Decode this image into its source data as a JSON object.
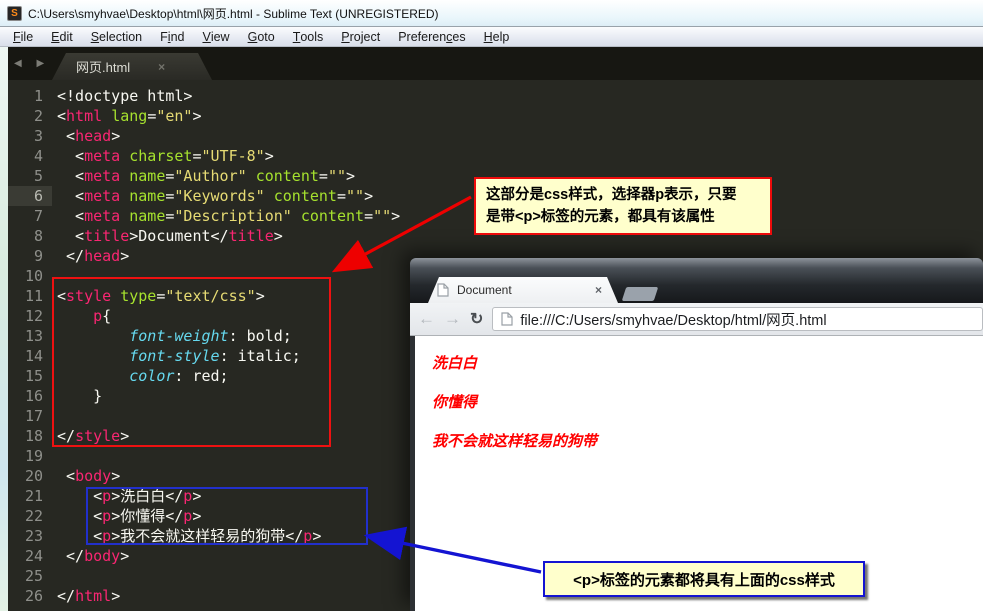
{
  "window": {
    "title": "C:\\Users\\smyhvae\\Desktop\\html\\网页.html - Sublime Text (UNREGISTERED)",
    "icon_letter": "S"
  },
  "menu": {
    "items": [
      {
        "label": "File",
        "u": 0
      },
      {
        "label": "Edit",
        "u": 0
      },
      {
        "label": "Selection",
        "u": 0
      },
      {
        "label": "Find",
        "u": 1
      },
      {
        "label": "View",
        "u": 0
      },
      {
        "label": "Goto",
        "u": 0
      },
      {
        "label": "Tools",
        "u": 0
      },
      {
        "label": "Project",
        "u": 0
      },
      {
        "label": "Preferences",
        "u": 8
      },
      {
        "label": "Help",
        "u": 0
      }
    ]
  },
  "tabbar": {
    "nav_arrows": "◀ ▶",
    "tab_label": "网页.html",
    "tab_close": "×"
  },
  "editor": {
    "highlighted_line": 6,
    "lines": [
      {
        "n": 1,
        "segs": [
          [
            "w",
            "<!doctype html>"
          ]
        ]
      },
      {
        "n": 2,
        "segs": [
          [
            "w",
            "<"
          ],
          [
            "p",
            "html"
          ],
          [
            "w",
            " "
          ],
          [
            "g",
            "lang"
          ],
          [
            "w",
            "="
          ],
          [
            "y",
            "\"en\""
          ],
          [
            "w",
            ">"
          ]
        ]
      },
      {
        "n": 3,
        "segs": [
          [
            "w",
            " <"
          ],
          [
            "p",
            "head"
          ],
          [
            "w",
            ">"
          ]
        ]
      },
      {
        "n": 4,
        "segs": [
          [
            "w",
            "  <"
          ],
          [
            "p",
            "meta"
          ],
          [
            "w",
            " "
          ],
          [
            "g",
            "charset"
          ],
          [
            "w",
            "="
          ],
          [
            "y",
            "\"UTF-8\""
          ],
          [
            "w",
            ">"
          ]
        ]
      },
      {
        "n": 5,
        "segs": [
          [
            "w",
            "  <"
          ],
          [
            "p",
            "meta"
          ],
          [
            "w",
            " "
          ],
          [
            "g",
            "name"
          ],
          [
            "w",
            "="
          ],
          [
            "y",
            "\"Author\""
          ],
          [
            "w",
            " "
          ],
          [
            "g",
            "content"
          ],
          [
            "w",
            "="
          ],
          [
            "y",
            "\"\""
          ],
          [
            "w",
            ">"
          ]
        ]
      },
      {
        "n": 6,
        "segs": [
          [
            "w",
            "  <"
          ],
          [
            "p",
            "meta"
          ],
          [
            "w",
            " "
          ],
          [
            "g",
            "name"
          ],
          [
            "w",
            "="
          ],
          [
            "y",
            "\"Keywords\""
          ],
          [
            "w",
            " "
          ],
          [
            "g",
            "content"
          ],
          [
            "w",
            "="
          ],
          [
            "y",
            "\"\""
          ],
          [
            "w",
            ">"
          ]
        ]
      },
      {
        "n": 7,
        "segs": [
          [
            "w",
            "  <"
          ],
          [
            "p",
            "meta"
          ],
          [
            "w",
            " "
          ],
          [
            "g",
            "name"
          ],
          [
            "w",
            "="
          ],
          [
            "y",
            "\"Description\""
          ],
          [
            "w",
            " "
          ],
          [
            "g",
            "content"
          ],
          [
            "w",
            "="
          ],
          [
            "y",
            "\"\""
          ],
          [
            "w",
            ">"
          ]
        ]
      },
      {
        "n": 8,
        "segs": [
          [
            "w",
            "  <"
          ],
          [
            "p",
            "title"
          ],
          [
            "w",
            ">Document</"
          ],
          [
            "p",
            "title"
          ],
          [
            "w",
            ">"
          ]
        ]
      },
      {
        "n": 9,
        "segs": [
          [
            "w",
            " </"
          ],
          [
            "p",
            "head"
          ],
          [
            "w",
            ">"
          ]
        ]
      },
      {
        "n": 10,
        "segs": []
      },
      {
        "n": 11,
        "segs": [
          [
            "w",
            "<"
          ],
          [
            "p",
            "style"
          ],
          [
            "w",
            " "
          ],
          [
            "g",
            "type"
          ],
          [
            "w",
            "="
          ],
          [
            "y",
            "\"text/css\""
          ],
          [
            "w",
            ">"
          ]
        ]
      },
      {
        "n": 12,
        "segs": [
          [
            "w",
            "    "
          ],
          [
            "p",
            "p"
          ],
          [
            "w",
            "{"
          ]
        ]
      },
      {
        "n": 13,
        "segs": [
          [
            "w",
            "        "
          ],
          [
            "c",
            "font-weight"
          ],
          [
            "w",
            ": bold;"
          ]
        ]
      },
      {
        "n": 14,
        "segs": [
          [
            "w",
            "        "
          ],
          [
            "c",
            "font-style"
          ],
          [
            "w",
            ": italic;"
          ]
        ]
      },
      {
        "n": 15,
        "segs": [
          [
            "w",
            "        "
          ],
          [
            "c",
            "color"
          ],
          [
            "w",
            ": red;"
          ]
        ]
      },
      {
        "n": 16,
        "segs": [
          [
            "w",
            "    }"
          ]
        ]
      },
      {
        "n": 17,
        "segs": []
      },
      {
        "n": 18,
        "segs": [
          [
            "w",
            "</"
          ],
          [
            "p",
            "style"
          ],
          [
            "w",
            ">"
          ]
        ]
      },
      {
        "n": 19,
        "segs": []
      },
      {
        "n": 20,
        "segs": [
          [
            "w",
            " <"
          ],
          [
            "p",
            "body"
          ],
          [
            "w",
            ">"
          ]
        ]
      },
      {
        "n": 21,
        "segs": [
          [
            "w",
            "    <"
          ],
          [
            "p",
            "p"
          ],
          [
            "w",
            ">洗白白</"
          ],
          [
            "p",
            "p"
          ],
          [
            "w",
            ">"
          ]
        ]
      },
      {
        "n": 22,
        "segs": [
          [
            "w",
            "    <"
          ],
          [
            "p",
            "p"
          ],
          [
            "w",
            ">你懂得</"
          ],
          [
            "p",
            "p"
          ],
          [
            "w",
            ">"
          ]
        ]
      },
      {
        "n": 23,
        "segs": [
          [
            "w",
            "    <"
          ],
          [
            "p",
            "p"
          ],
          [
            "w",
            ">我不会就这样轻易的狗带</"
          ],
          [
            "p",
            "p"
          ],
          [
            "w",
            ">"
          ]
        ]
      },
      {
        "n": 24,
        "segs": [
          [
            "w",
            " </"
          ],
          [
            "p",
            "body"
          ],
          [
            "w",
            ">"
          ]
        ]
      },
      {
        "n": 25,
        "segs": []
      },
      {
        "n": 26,
        "segs": [
          [
            "w",
            "</"
          ],
          [
            "p",
            "html"
          ],
          [
            "w",
            ">"
          ]
        ]
      }
    ]
  },
  "annotations": {
    "css_note_line1": "这部分是css样式，选择器p表示，只要",
    "css_note_line2": "是带<p>标签的元素，都具有该属性",
    "p_note": "<p>标签的元素都将具有上面的css样式"
  },
  "browser": {
    "tab_title": "Document",
    "tab_close": "×",
    "back": "←",
    "forward": "→",
    "reload": "↻",
    "url": "file:///C:/Users/smyhvae/Desktop/html/网页.html",
    "paragraphs": [
      "洗白白",
      "你懂得",
      "我不会就这样轻易的狗带"
    ]
  },
  "colors": {
    "editor_bg": "#272822",
    "syntax_tag": "#f92672",
    "syntax_attr": "#a6e22e",
    "syntax_string": "#e6db74",
    "syntax_property": "#66d9ef",
    "note_bg": "#ffffcc",
    "note_red_border": "#ee0b0b",
    "note_blue_border": "#1414d2",
    "rendered_text_red": "#ff0000"
  }
}
